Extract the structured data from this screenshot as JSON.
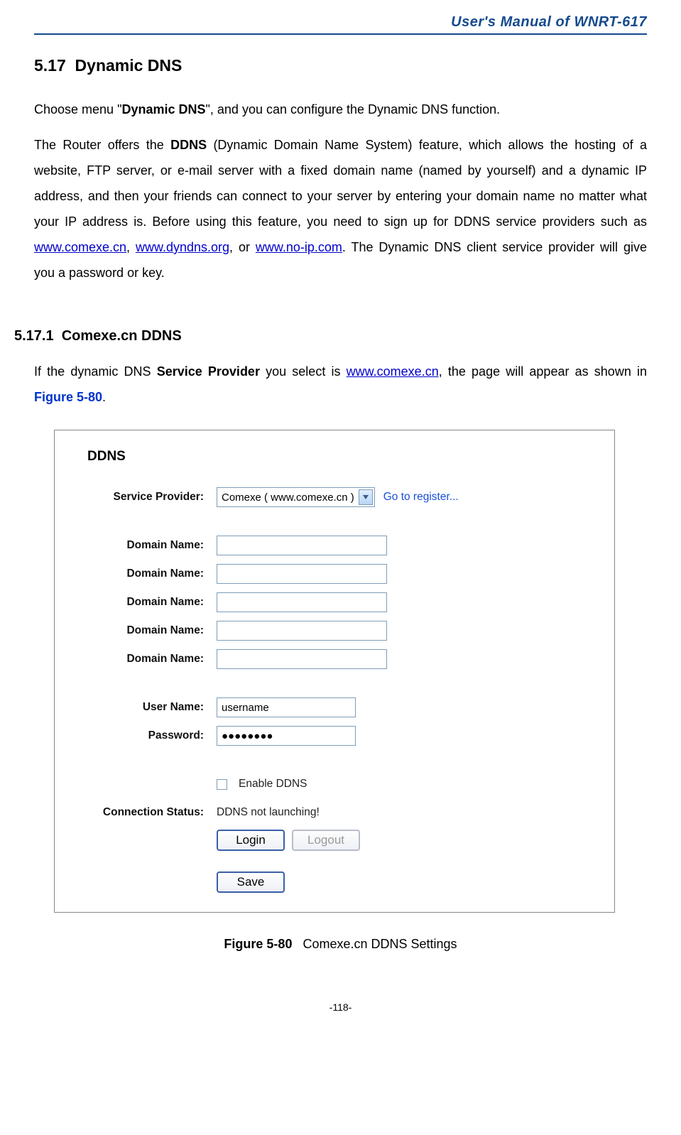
{
  "header": {
    "doc_title": "User's Manual of WNRT-617"
  },
  "section": {
    "number": "5.17",
    "title": "Dynamic DNS",
    "para1_a": "Choose menu \"",
    "para1_b": "Dynamic DNS",
    "para1_c": "\", and you can configure the Dynamic DNS function.",
    "para2_a": "The Router offers the ",
    "para2_b": "DDNS",
    "para2_c": " (Dynamic Domain Name System) feature, which allows the hosting of a website, FTP server, or e-mail server with a fixed domain name (named by yourself) and a dynamic IP address, and then your friends can connect to your server by entering your domain name no matter what your IP address is. Before using this feature, you need to sign up for DDNS service providers such as ",
    "para2_link1": "www.comexe.cn",
    "para2_d": ", ",
    "para2_link2": "www.dyndns.org",
    "para2_e": ", or ",
    "para2_link3": "www.no-ip.com",
    "para2_f": ". The Dynamic DNS client service provider will give you a password or key."
  },
  "subsection": {
    "number": "5.17.1",
    "title": "Comexe.cn DDNS",
    "para_a": "If the dynamic DNS ",
    "para_b": "Service Provider",
    "para_c": " you select is ",
    "para_link": "www.comexe.cn",
    "para_d": ", the page will appear as shown in ",
    "para_figref": "Figure 5-80",
    "para_e": "."
  },
  "screenshot": {
    "title": "DDNS",
    "labels": {
      "service_provider": "Service Provider:",
      "domain_name": "Domain Name:",
      "user_name": "User Name:",
      "password": "Password:",
      "connection_status": "Connection Status:"
    },
    "select_value": "Comexe ( www.comexe.cn )",
    "register_link": "Go to register...",
    "username_value": "username",
    "password_value": "●●●●●●●●",
    "enable_label": "Enable DDNS",
    "status_value": "DDNS not launching!",
    "buttons": {
      "login": "Login",
      "logout": "Logout",
      "save": "Save"
    }
  },
  "caption": {
    "fig_label": "Figure 5-80",
    "fig_desc": "Comexe.cn DDNS Settings"
  },
  "footer": {
    "page_number": "-118-"
  }
}
